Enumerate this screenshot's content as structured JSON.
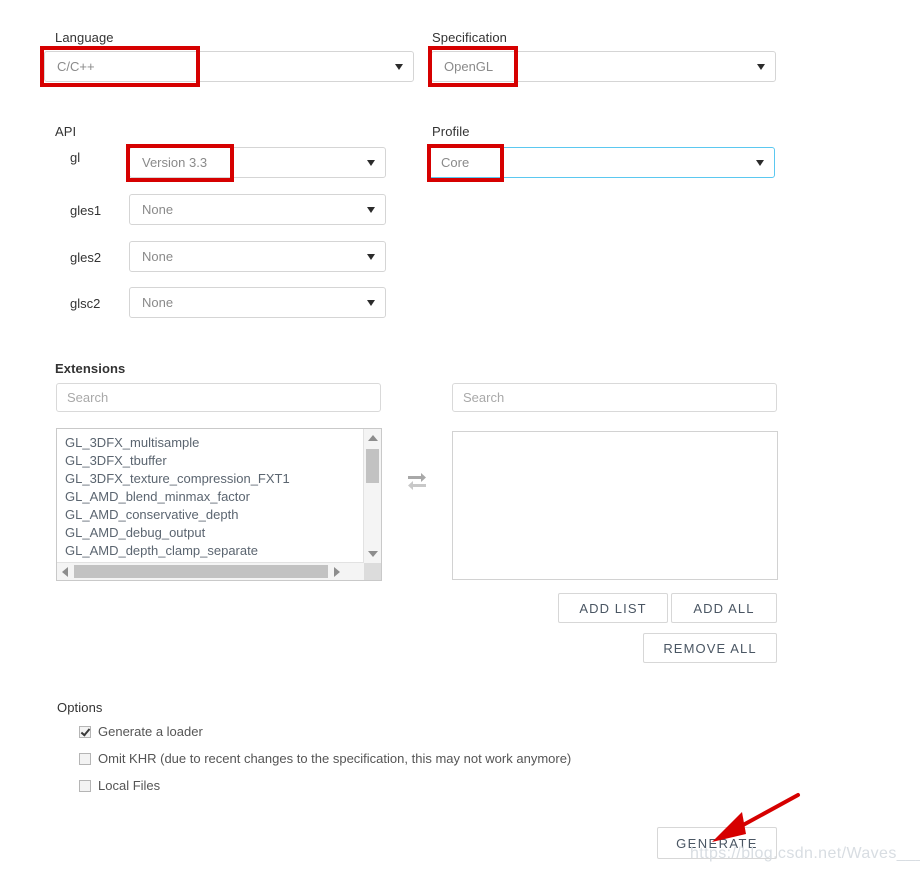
{
  "language": {
    "label": "Language",
    "value": "C/C++"
  },
  "specification": {
    "label": "Specification",
    "value": "OpenGL"
  },
  "api": {
    "label": "API",
    "rows": [
      {
        "name": "gl",
        "value": "Version 3.3"
      },
      {
        "name": "gles1",
        "value": "None"
      },
      {
        "name": "gles2",
        "value": "None"
      },
      {
        "name": "glsc2",
        "value": "None"
      }
    ]
  },
  "profile": {
    "label": "Profile",
    "value": "Core"
  },
  "extensions": {
    "label": "Extensions",
    "left_search_placeholder": "Search",
    "right_search_placeholder": "Search",
    "available": [
      "GL_3DFX_multisample",
      "GL_3DFX_tbuffer",
      "GL_3DFX_texture_compression_FXT1",
      "GL_AMD_blend_minmax_factor",
      "GL_AMD_conservative_depth",
      "GL_AMD_debug_output",
      "GL_AMD_depth_clamp_separate"
    ],
    "selected": [],
    "swap_icon": "exchange-arrows-icon",
    "buttons": {
      "add_list": "ADD LIST",
      "add_all": "ADD ALL",
      "remove_all": "REMOVE ALL"
    }
  },
  "options": {
    "label": "Options",
    "items": [
      {
        "label": "Generate a loader",
        "checked": true
      },
      {
        "label": "Omit KHR (due to recent changes to the specification, this may not work anymore)",
        "checked": false
      },
      {
        "label": "Local Files",
        "checked": false
      }
    ]
  },
  "generate": {
    "label": "GENERATE"
  },
  "watermark": {
    "text": "https://blog.csdn.net/Waves___"
  },
  "colors": {
    "annotation_red": "#d60000",
    "focus_blue": "#5bc8f0",
    "border_gray": "#d5d5d5"
  }
}
